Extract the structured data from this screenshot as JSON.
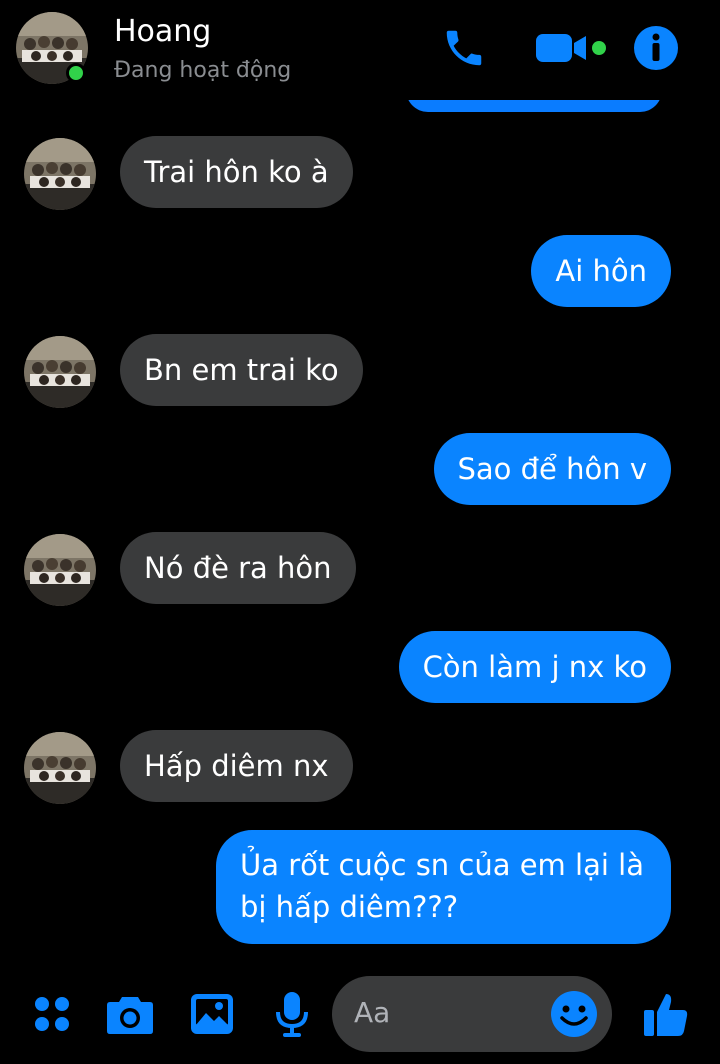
{
  "header": {
    "name": "Hoang",
    "status": "Đang hoạt động"
  },
  "messages": [
    {
      "side": "in",
      "text": "Trai hôn ko à"
    },
    {
      "side": "out",
      "text": "Ai hôn"
    },
    {
      "side": "in",
      "text": "Bn em trai ko"
    },
    {
      "side": "out",
      "text": "Sao để hôn v"
    },
    {
      "side": "in",
      "text": "Nó đè ra hôn"
    },
    {
      "side": "out",
      "text": "Còn làm j nx ko"
    },
    {
      "side": "in",
      "text": "Hấp diêm nx"
    },
    {
      "side": "out",
      "text": "Ủa rốt cuộc sn của em lại là bị hấp diêm???"
    }
  ],
  "composer": {
    "placeholder": "Aa"
  },
  "colors": {
    "accent": "#0a84ff",
    "incoming_bubble": "#3a3b3c",
    "online": "#31d24a",
    "background": "#000000"
  },
  "icons": [
    "phone-icon",
    "video-camera-icon",
    "info-icon",
    "apps-grid-icon",
    "camera-icon",
    "gallery-icon",
    "microphone-icon",
    "emoji-icon",
    "thumbs-up-icon"
  ]
}
